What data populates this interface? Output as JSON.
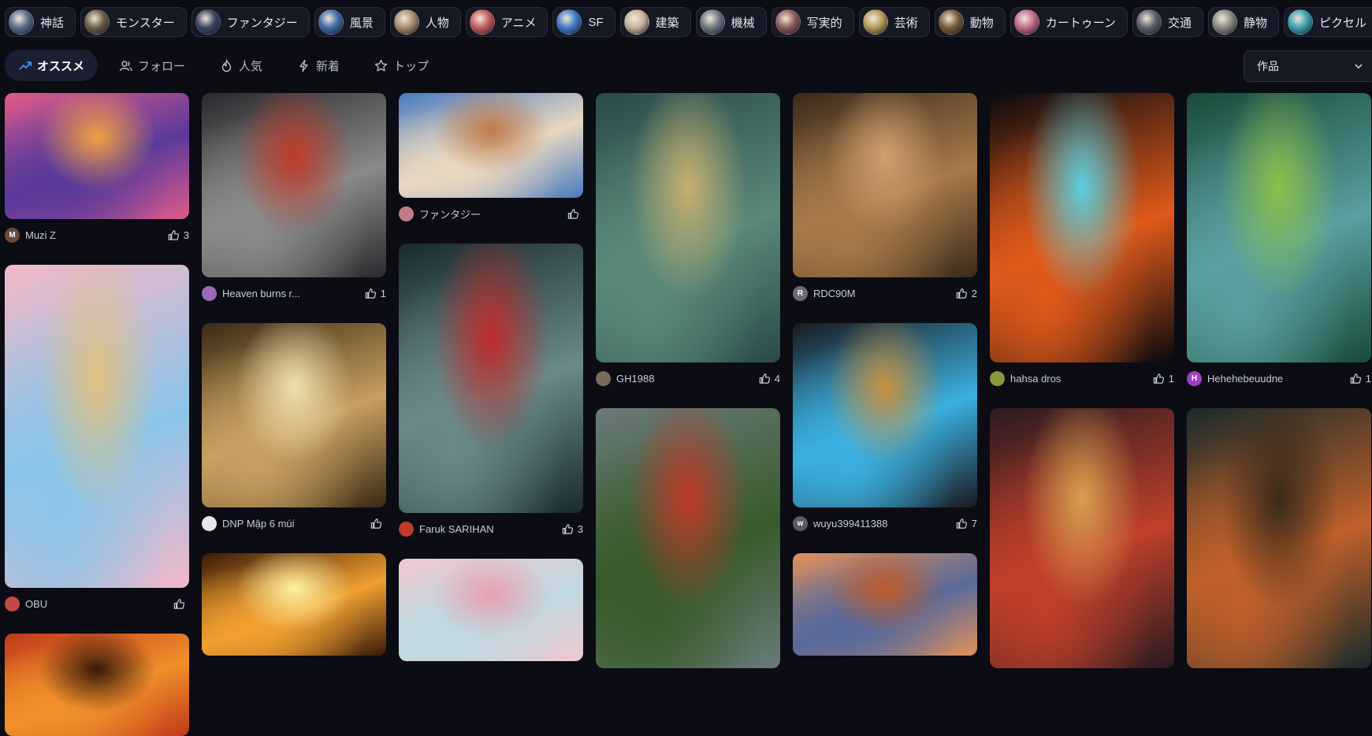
{
  "categories": [
    {
      "label": "神話",
      "color": "#5a6c8c"
    },
    {
      "label": "モンスター",
      "color": "#6b5c48"
    },
    {
      "label": "ファンタジー",
      "color": "#3b4561"
    },
    {
      "label": "風景",
      "color": "#3f6aa8"
    },
    {
      "label": "人物",
      "color": "#a88d70"
    },
    {
      "label": "アニメ",
      "color": "#c45a5a"
    },
    {
      "label": "SF",
      "color": "#3f7ac8"
    },
    {
      "label": "建築",
      "color": "#c9b39a"
    },
    {
      "label": "機械",
      "color": "#6f7684"
    },
    {
      "label": "写実的",
      "color": "#8c5a5a"
    },
    {
      "label": "芸術",
      "color": "#b49a5a"
    },
    {
      "label": "動物",
      "color": "#7a5a3a"
    },
    {
      "label": "カートゥーン",
      "color": "#c46a8a"
    },
    {
      "label": "交通",
      "color": "#5a5f6a"
    },
    {
      "label": "静物",
      "color": "#8a8a80"
    },
    {
      "label": "ピクセル",
      "color": "#3aa0b0"
    }
  ],
  "tabs": [
    {
      "label": "オススメ",
      "icon": "trending-icon",
      "active": true
    },
    {
      "label": "フォロー",
      "icon": "users-icon",
      "active": false
    },
    {
      "label": "人気",
      "icon": "flame-icon",
      "active": false
    },
    {
      "label": "新着",
      "icon": "bolt-icon",
      "active": false
    },
    {
      "label": "トップ",
      "icon": "star-icon",
      "active": false
    }
  ],
  "sort_select": {
    "value": "作品"
  },
  "columns": [
    [
      {
        "author": "Muzi Z",
        "avatar": "M",
        "avatar_color": "#6a4a3a",
        "likes": "3",
        "palette": [
          "#e05a8a",
          "#5a3a9a",
          "#f0a040"
        ]
      },
      {
        "author": "OBU",
        "avatar": "",
        "avatar_color": "#c44a4a",
        "likes": "",
        "palette": [
          "#f2b8c8",
          "#8ac4e8",
          "#e0c080"
        ]
      },
      {
        "author": "",
        "avatar": "",
        "avatar_color": "#444",
        "likes": "",
        "palette": [
          "#c03a1a",
          "#f0902a",
          "#3a1a0a"
        ]
      }
    ],
    [
      {
        "author": "Heaven burns r...",
        "avatar": "",
        "avatar_color": "#9a6aba",
        "likes": "1",
        "palette": [
          "#2a2a2e",
          "#8a8a8a",
          "#c03a2a"
        ]
      },
      {
        "author": "DNP Mập 6 múi",
        "avatar": "",
        "avatar_color": "#e8e8e8",
        "likes": "",
        "palette": [
          "#3a2a14",
          "#c8a060",
          "#f0e0b0"
        ]
      },
      {
        "author": "",
        "avatar": "",
        "avatar_color": "#444",
        "likes": "",
        "palette": [
          "#3a1a08",
          "#f0a030",
          "#fff0a0"
        ]
      }
    ],
    [
      {
        "author": "ファンタジー",
        "avatar": "",
        "avatar_color": "#c47a8a",
        "likes": "",
        "palette": [
          "#4a7ac0",
          "#e8d8c0",
          "#c07a4a"
        ]
      },
      {
        "author": "Faruk SARIHAN",
        "avatar": "",
        "avatar_color": "#c03a2a",
        "likes": "3",
        "palette": [
          "#1a2a2e",
          "#6a8a8a",
          "#c02a2a"
        ]
      },
      {
        "author": "",
        "avatar": "",
        "avatar_color": "#444",
        "likes": "",
        "palette": [
          "#f0c8d0",
          "#c0d8e0",
          "#e8a0b0"
        ]
      }
    ],
    [
      {
        "author": "GH1988",
        "avatar": "",
        "avatar_color": "#7a6a5a",
        "likes": "4",
        "palette": [
          "#2a4a4a",
          "#5a8a7a",
          "#c8b070"
        ]
      },
      {
        "author": "",
        "avatar": "",
        "avatar_color": "#444",
        "likes": "",
        "palette": [
          "#6a7a7a",
          "#3a5a2a",
          "#c03a2a"
        ]
      }
    ],
    [
      {
        "author": "RDC90M",
        "avatar": "R",
        "avatar_color": "#6a6a7a",
        "likes": "2",
        "palette": [
          "#3a2a1a",
          "#a87a4a",
          "#d0a070"
        ]
      },
      {
        "author": "wuyu399411388",
        "avatar": "w",
        "avatar_color": "#5a5a6a",
        "likes": "7",
        "palette": [
          "#1a1a20",
          "#3ab0e0",
          "#c89040"
        ]
      },
      {
        "author": "",
        "avatar": "",
        "avatar_color": "#444",
        "likes": "",
        "palette": [
          "#e0905a",
          "#5a6a9a",
          "#c05a2a"
        ]
      }
    ],
    [
      {
        "author": "hahsa dros",
        "avatar": "",
        "avatar_color": "#8a9a3a",
        "likes": "1",
        "palette": [
          "#0a0a0e",
          "#e05a1a",
          "#5ad0e0"
        ]
      },
      {
        "author": "",
        "avatar": "",
        "avatar_color": "#444",
        "likes": "",
        "palette": [
          "#2a1a20",
          "#c0402a",
          "#d8a050"
        ]
      }
    ],
    [
      {
        "author": "Hehehebeuudne",
        "avatar": "H",
        "avatar_color": "#a040c0",
        "likes": "1",
        "palette": [
          "#1a4a3a",
          "#5aa0a0",
          "#8ac04a"
        ]
      },
      {
        "author": "",
        "avatar": "",
        "avatar_color": "#444",
        "likes": "",
        "palette": [
          "#1a2a2a",
          "#c0602a",
          "#3a2a1a"
        ]
      }
    ]
  ]
}
